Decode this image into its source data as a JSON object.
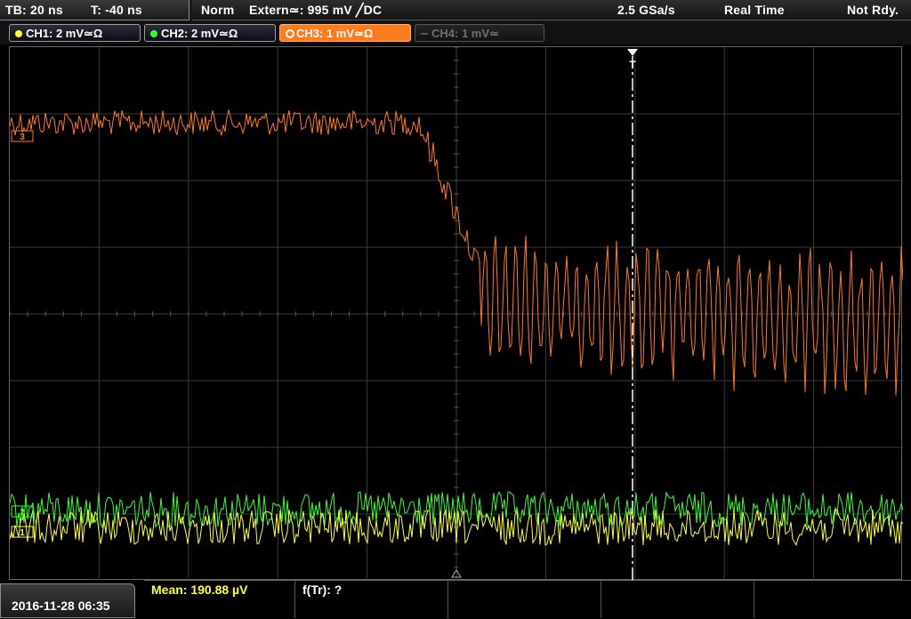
{
  "status": {
    "timebase": "TB: 20 ns",
    "time_offset": "T: -40 ns",
    "trigger_mode": "Norm",
    "trigger_source": "Extern≃: 995 mV ╱DC",
    "sample_rate": "2.5 GSa/s",
    "acq_mode": "Real Time",
    "run_state": "Not Rdy."
  },
  "channels": [
    {
      "label": "CH1: 2 mV≃Ω",
      "color": "#ffff33",
      "state": "on"
    },
    {
      "label": "CH2: 2 mV≃Ω",
      "color": "#33ff33",
      "state": "on"
    },
    {
      "label": "CH3: 1 mV≃Ω",
      "color": "#ff7b1c",
      "state": "active"
    },
    {
      "label": "CH4: 1 mV≃",
      "color": "#777777",
      "state": "off"
    }
  ],
  "markers": {
    "ch3_marker": "3",
    "ch2_marker": "2",
    "ch1_marker": "1",
    "trigger_marker": "T"
  },
  "footer": {
    "datetime": "2016-11-28 06:35",
    "meas1": "Mean: 190.88 µV",
    "meas2": "f(Tr): ?"
  },
  "colors": {
    "ch1": "#ffff33",
    "ch2": "#33ff33",
    "ch3": "#ff7b1c",
    "grid": "#3a3a3a",
    "trigger_line": "#ffffff"
  }
}
